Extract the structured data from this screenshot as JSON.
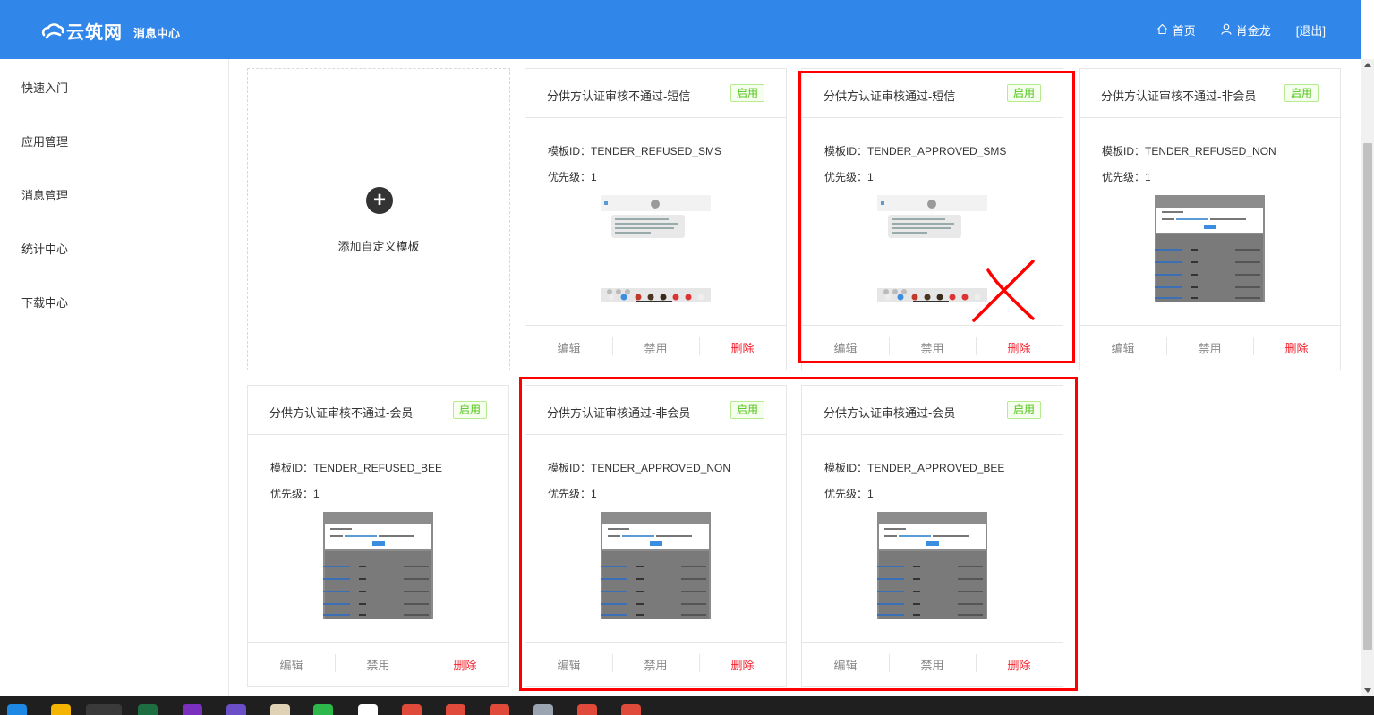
{
  "header": {
    "brand": "云筑网",
    "subtitle": "消息中心",
    "nav": {
      "home": "首页",
      "user": "肖金龙",
      "logout": "[退出]"
    }
  },
  "sidebar": {
    "items": [
      {
        "label": "快速入门"
      },
      {
        "label": "应用管理"
      },
      {
        "label": "消息管理"
      },
      {
        "label": "统计中心"
      },
      {
        "label": "下载中心"
      }
    ]
  },
  "add_card": {
    "label": "添加自定义模板"
  },
  "cards": [
    {
      "title": "分供方认证审核不通过-短信",
      "status": "启用",
      "id_text": "模板ID：TENDER_REFUSED_SMS",
      "priority_text": "优先级：1",
      "preview": "sms",
      "actions": {
        "edit": "编辑",
        "disable": "禁用",
        "delete": "删除"
      }
    },
    {
      "title": "分供方认证审核通过-短信",
      "status": "启用",
      "id_text": "模板ID：TENDER_APPROVED_SMS",
      "priority_text": "优先级：1",
      "preview": "sms",
      "actions": {
        "edit": "编辑",
        "disable": "禁用",
        "delete": "删除"
      }
    },
    {
      "title": "分供方认证审核不通过-非会员",
      "status": "启用",
      "id_text": "模板ID：TENDER_REFUSED_NON",
      "priority_text": "优先级：1",
      "preview": "web",
      "actions": {
        "edit": "编辑",
        "disable": "禁用",
        "delete": "删除"
      }
    },
    {
      "title": "分供方认证审核不通过-会员",
      "status": "启用",
      "id_text": "模板ID：TENDER_REFUSED_BEE",
      "priority_text": "优先级：1",
      "preview": "web",
      "actions": {
        "edit": "编辑",
        "disable": "禁用",
        "delete": "删除"
      }
    },
    {
      "title": "分供方认证审核通过-非会员",
      "status": "启用",
      "id_text": "模板ID：TENDER_APPROVED_NON",
      "priority_text": "优先级：1",
      "preview": "web",
      "actions": {
        "edit": "编辑",
        "disable": "禁用",
        "delete": "删除"
      }
    },
    {
      "title": "分供方认证审核通过-会员",
      "status": "启用",
      "id_text": "模板ID：TENDER_APPROVED_BEE",
      "priority_text": "优先级：1",
      "preview": "web",
      "actions": {
        "edit": "编辑",
        "disable": "禁用",
        "delete": "删除"
      }
    }
  ],
  "colors": {
    "header": "#3187e9",
    "status_green": "#52c41a",
    "delete_red": "#f5222d",
    "annotation_red": "#ff0000"
  }
}
